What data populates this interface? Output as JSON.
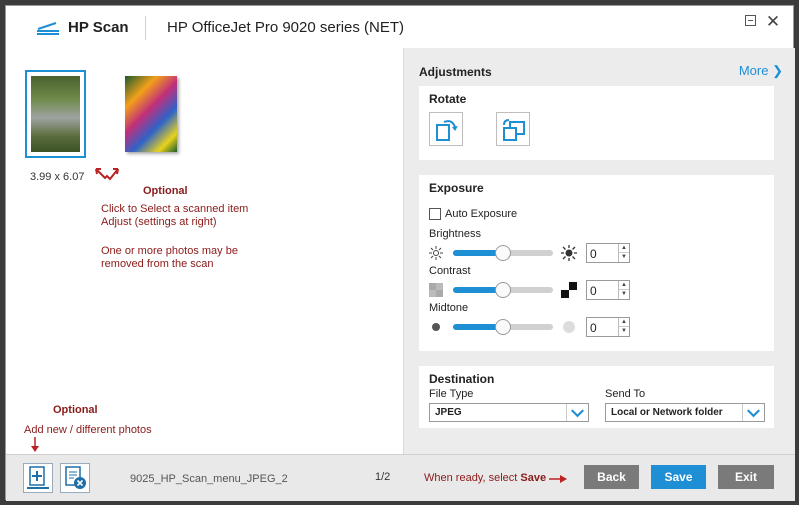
{
  "titlebar": {
    "app_title": "HP Scan",
    "printer_title": "HP OfficeJet Pro 9020 series (NET)"
  },
  "left": {
    "thumb_dims": "3.99  x  6.07",
    "optional_1": "Optional",
    "note_select": [
      "Click to Select a scanned item",
      "Adjust (settings at right)"
    ],
    "note_remove": [
      "One or more photos may be",
      "removed from the scan"
    ],
    "optional_2": "Optional",
    "note_add": "Add new / different photos"
  },
  "adjustments": {
    "title": "Adjustments",
    "more": "More",
    "rotate": {
      "title": "Rotate"
    },
    "exposure": {
      "title": "Exposure",
      "auto_label": "Auto Exposure",
      "auto_checked": false,
      "brightness": {
        "label": "Brightness",
        "value": "0",
        "level": 0.5
      },
      "contrast": {
        "label": "Contrast",
        "value": "0",
        "level": 0.5
      },
      "midtone": {
        "label": "Midtone",
        "value": "0",
        "level": 0.5
      }
    },
    "destination": {
      "title": "Destination",
      "file_type_label": "File Type",
      "file_type_value": "JPEG",
      "send_to_label": "Send To",
      "send_to_value": "Local or Network folder"
    }
  },
  "bottom": {
    "filename": "9025_HP_Scan_menu_JPEG_2",
    "page_count": "1/2",
    "ready_prefix": "When ready, select ",
    "ready_action": "Save",
    "back": "Back",
    "save": "Save",
    "exit": "Exit"
  },
  "colors": {
    "accent": "#1e8fd4",
    "annotation": "#8b1a1a",
    "gray_button": "#7a7a7a"
  }
}
